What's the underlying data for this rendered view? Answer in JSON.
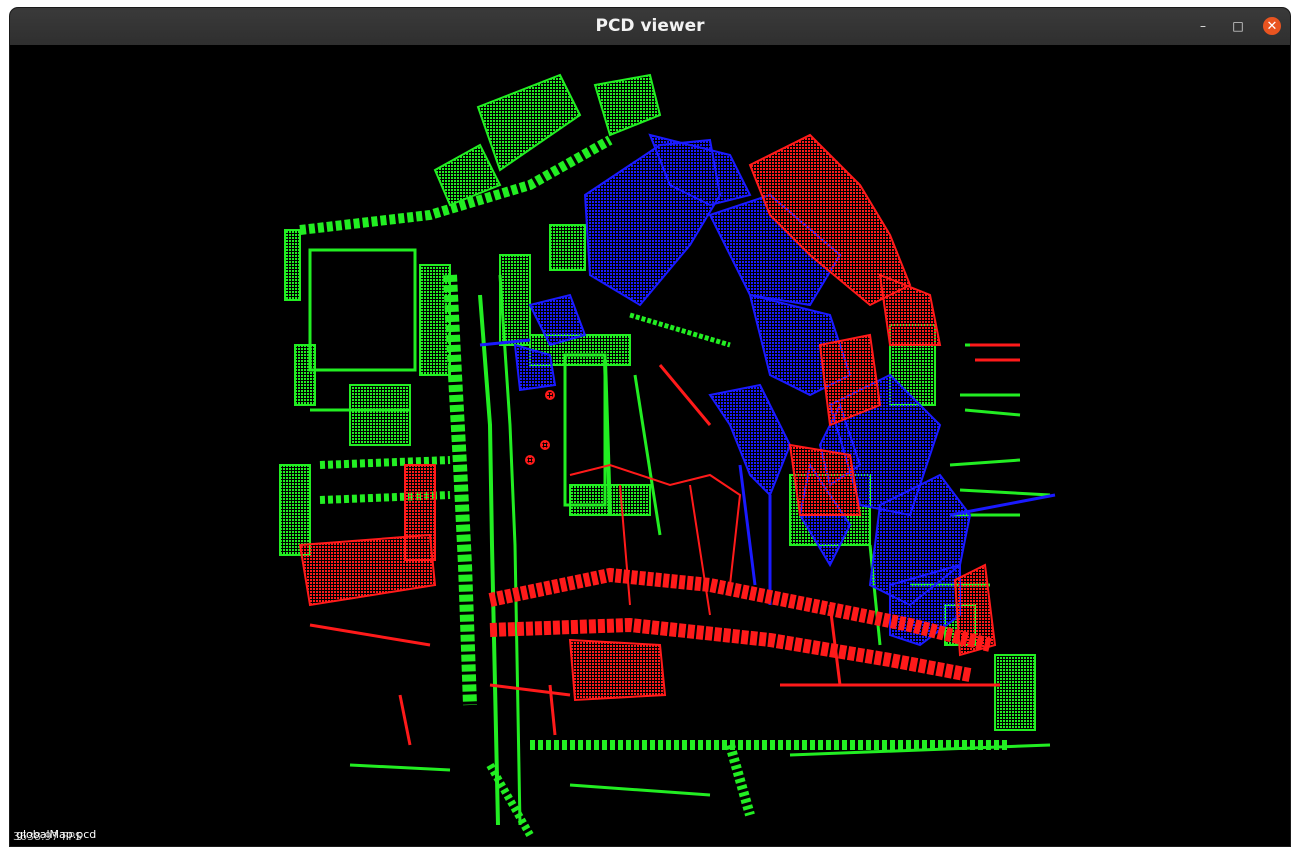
{
  "window": {
    "title": "PCD viewer",
    "minimize_label": "–",
    "maximize_label": "□",
    "close_label": "✕"
  },
  "viewer": {
    "background": "#000000",
    "point_colors": {
      "green": "#22ee22",
      "red": "#ff1a1a",
      "blue": "#1a1aff"
    },
    "overlay": {
      "fps_text": "3638.97 FPS",
      "filename": "globalMap.pcd"
    }
  }
}
